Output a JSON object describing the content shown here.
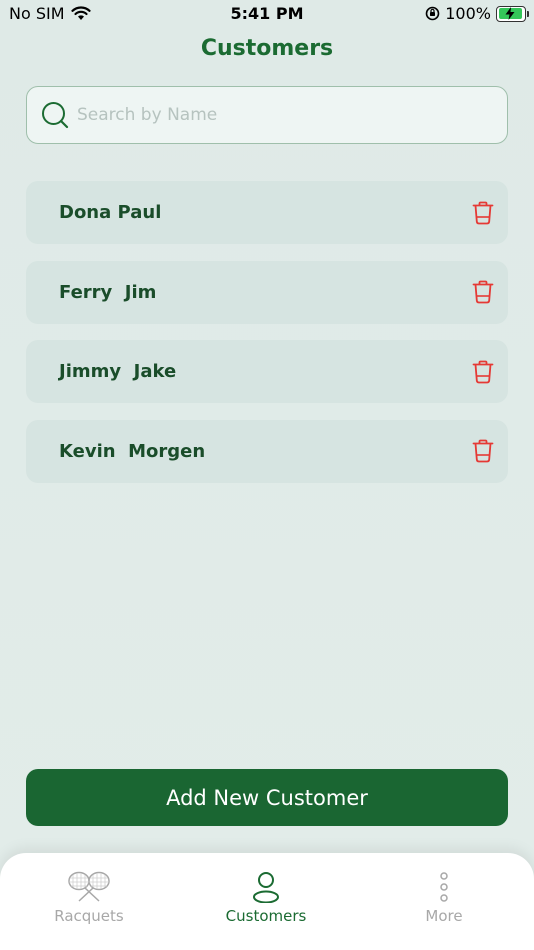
{
  "status_bar": {
    "carrier": "No SIM",
    "time": "5:41 PM",
    "battery": "100%"
  },
  "header": {
    "title": "Customers"
  },
  "search": {
    "placeholder": "Search by Name",
    "value": ""
  },
  "customers": [
    {
      "name": "Dona Paul"
    },
    {
      "name": "Ferry  Jim"
    },
    {
      "name": "Jimmy  Jake"
    },
    {
      "name": "Kevin  Morgen"
    }
  ],
  "actions": {
    "add_label": "Add New Customer"
  },
  "tabs": [
    {
      "label": "Racquets",
      "icon": "racquets-icon",
      "active": false
    },
    {
      "label": "Customers",
      "icon": "person-icon",
      "active": true
    },
    {
      "label": "More",
      "icon": "more-icon",
      "active": false
    }
  ],
  "colors": {
    "brand": "#1a6632",
    "delete": "#e53935",
    "inactive_tab": "#a8a8a8"
  }
}
